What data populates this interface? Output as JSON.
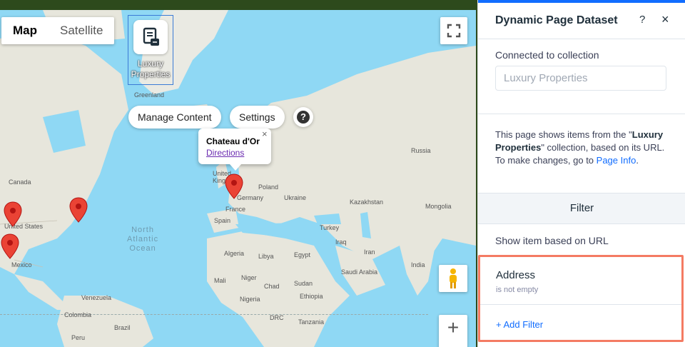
{
  "map": {
    "type_tabs": [
      "Map",
      "Satellite"
    ],
    "active_tab": "Map",
    "dataset_widget_label": "Luxury Properties",
    "manage_content_label": "Manage Content",
    "settings_label": "Settings",
    "help_label": "?",
    "info_window": {
      "title": "Chateau d'Or",
      "link": "Directions",
      "close": "×"
    },
    "zoom_in_label": "+",
    "ocean_label": "North\nAtlantic\nOcean",
    "labels": {
      "greenland": "Greenland",
      "canada": "Canada",
      "united_states": "United States",
      "mexico": "Mexico",
      "united_kingdom": "United\nKingdom",
      "germany": "Germany",
      "poland": "Poland",
      "ukraine": "Ukraine",
      "france": "France",
      "spain": "Spain",
      "russia": "Russia",
      "kazakhstan": "Kazakhstan",
      "mongolia": "Mongolia",
      "turkey": "Turkey",
      "iraq": "Iraq",
      "iran": "Iran",
      "algeria": "Algeria",
      "libya": "Libya",
      "egypt": "Egypt",
      "saudi_arabia": "Saudi Arabia",
      "mali": "Mali",
      "niger": "Niger",
      "chad": "Chad",
      "sudan": "Sudan",
      "nigeria": "Nigeria",
      "ethiopia": "Ethiopia",
      "venezuela": "Venezuela",
      "colombia": "Colombia",
      "drc": "DRC",
      "tanzania": "Tanzania",
      "brazil": "Brazil",
      "peru": "Peru",
      "india": "India"
    },
    "colors": {
      "water": "#8fd8f4",
      "land": "#e8e8e0",
      "pin": "#ea4335"
    }
  },
  "panel": {
    "title": "Dynamic Page Dataset",
    "help": "?",
    "close": "×",
    "connected_label": "Connected to collection",
    "collection_value": "Luxury Properties",
    "info_before": "This page shows items from the \"",
    "info_collection": "Luxury Properties",
    "info_after": "\" collection, based on its URL. To make changes, go to ",
    "info_link": "Page Info",
    "info_end": ".",
    "filter_heading": "Filter",
    "show_item_label": "Show item based on URL",
    "filter_field": "Address",
    "filter_condition": "is not empty",
    "add_filter": "+ Add Filter",
    "colors": {
      "accent": "#116dff",
      "highlight_border": "#f47b63"
    }
  }
}
